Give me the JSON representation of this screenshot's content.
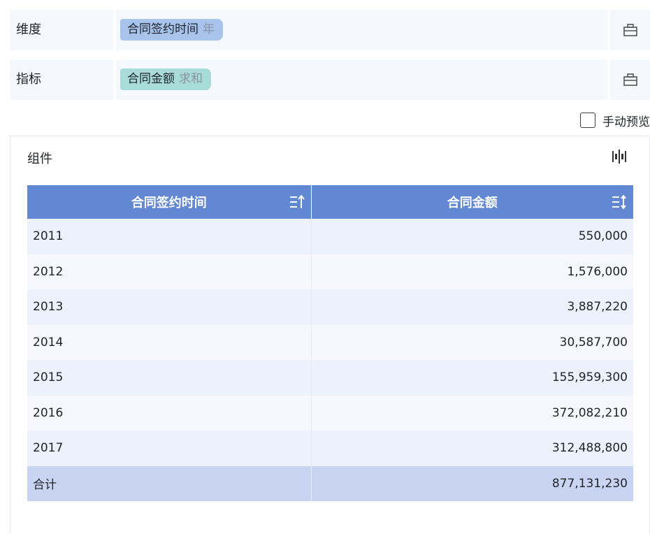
{
  "shelves": {
    "dimension": {
      "label": "维度",
      "field": "合同签约时间",
      "modifier": "年"
    },
    "measure": {
      "label": "指标",
      "field": "合同金额",
      "modifier": "求和"
    }
  },
  "manual_preview": {
    "label": "手动预览",
    "checked": false
  },
  "component": {
    "title": "组件",
    "switch_icon": "chart-switch-icon",
    "columns": [
      "合同签约时间",
      "合同金额"
    ],
    "rows": [
      {
        "year": "2011",
        "amount": "550,000"
      },
      {
        "year": "2012",
        "amount": "1,576,000"
      },
      {
        "year": "2013",
        "amount": "3,887,220"
      },
      {
        "year": "2014",
        "amount": "30,587,700"
      },
      {
        "year": "2015",
        "amount": "155,959,300"
      },
      {
        "year": "2016",
        "amount": "372,082,210"
      },
      {
        "year": "2017",
        "amount": "312,488,800"
      }
    ],
    "total": {
      "label": "合计",
      "amount": "877,131,230"
    }
  },
  "colors": {
    "header": "#6287d3",
    "dimension_pill": "#a9c4ec",
    "measure_pill": "#a8dcd9",
    "total_row": "#c8d4f1"
  }
}
